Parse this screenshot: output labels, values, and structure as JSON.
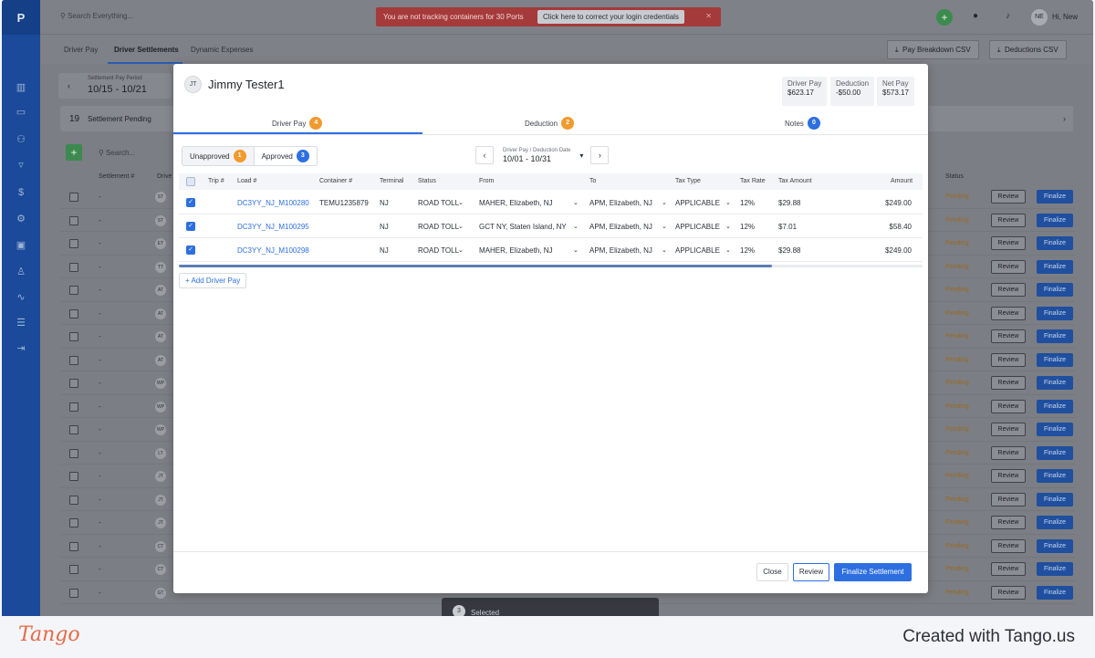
{
  "app": {
    "logo": "P",
    "search_placeholder": "Search Everything...",
    "alert_text": "You are not tracking containers for 30 Ports",
    "alert_button": "Click here to correct your login credentials",
    "alert_close": "✕",
    "user_initials": "NE",
    "user_greeting": "Hi, New"
  },
  "subtabs": [
    "Driver Pay",
    "Driver Settlements",
    "Dynamic Expenses"
  ],
  "csv_buttons": [
    "Pay Breakdown CSV",
    "Deductions CSV"
  ],
  "background": {
    "period_label": "Settlement Pay Period",
    "period_value": "10/15 - 10/21",
    "pending_count": "19",
    "pending_label": "Settlement Pending",
    "search_placeholder": "Search...",
    "col_settlement": "Settlement #",
    "col_driver": "Drive",
    "col_status": "Status",
    "rows": [
      {
        "ini": "ST",
        "status": "Pending"
      },
      {
        "ini": "ST",
        "status": "Pending"
      },
      {
        "ini": "ET",
        "status": "Pending"
      },
      {
        "ini": "TT",
        "status": "Pending"
      },
      {
        "ini": "AT",
        "status": "Pending"
      },
      {
        "ini": "AT",
        "status": "Pending"
      },
      {
        "ini": "AT",
        "status": "Pending"
      },
      {
        "ini": "AT",
        "status": "Pending"
      },
      {
        "ini": "WP",
        "status": "Pending"
      },
      {
        "ini": "WP",
        "status": "Pending"
      },
      {
        "ini": "WP",
        "status": "Pending"
      },
      {
        "ini": "LT",
        "status": "Pending"
      },
      {
        "ini": "JT",
        "status": "Pending"
      },
      {
        "ini": "JT",
        "status": "Pending"
      },
      {
        "ini": "JT",
        "status": "Pending"
      },
      {
        "ini": "CT",
        "status": "Pending"
      },
      {
        "ini": "CT",
        "status": "Pending"
      },
      {
        "ini": "GT",
        "status": "Pending"
      }
    ],
    "review_label": "Review",
    "finalize_label": "Finalize",
    "selected_count": "3",
    "selected_label": "Selected"
  },
  "modal": {
    "initials": "JT",
    "driver_name": "Jimmy Tester1",
    "summary": [
      {
        "label": "Driver Pay",
        "value": "$623.17"
      },
      {
        "label": "Deduction",
        "value": "-$50.00"
      },
      {
        "label": "Net Pay",
        "value": "$573.17"
      }
    ],
    "tabs": [
      {
        "label": "Driver Pay",
        "count": "4",
        "color": "orange"
      },
      {
        "label": "Deduction",
        "count": "2",
        "color": "orange"
      },
      {
        "label": "Notes",
        "count": "0",
        "color": "blue"
      }
    ],
    "toggle": [
      {
        "label": "Unapproved",
        "count": "1"
      },
      {
        "label": "Approved",
        "count": "3"
      }
    ],
    "date_label": "Driver Pay / Deduction Date",
    "date_value": "10/01 - 10/31",
    "columns": [
      "Trip #",
      "Load #",
      "Container #",
      "Terminal",
      "Status",
      "From",
      "To",
      "Tax Type",
      "Tax Rate",
      "Tax Amount",
      "Amount"
    ],
    "rows": [
      {
        "load": "DC3YY_NJ_M100280",
        "container": "TEMU1235879",
        "terminal": "NJ",
        "status": "ROAD TOLL",
        "from": "MAHER, Elizabeth, NJ",
        "to": "APM, Elizabeth, NJ",
        "tax_type": "APPLICABLE",
        "tax_rate": "12%",
        "tax_amount": "$29.88",
        "amount": "$249.00"
      },
      {
        "load": "DC3YY_NJ_M100295",
        "container": "",
        "terminal": "NJ",
        "status": "ROAD TOLL",
        "from": "GCT NY, Staten Island, NY",
        "to": "APM, Elizabeth, NJ",
        "tax_type": "APPLICABLE",
        "tax_rate": "12%",
        "tax_amount": "$7.01",
        "amount": "$58.40"
      },
      {
        "load": "DC3YY_NJ_M100298",
        "container": "",
        "terminal": "NJ",
        "status": "ROAD TOLL",
        "from": "MAHER, Elizabeth, NJ",
        "to": "APM, Elizabeth, NJ",
        "tax_type": "APPLICABLE",
        "tax_rate": "12%",
        "tax_amount": "$29.88",
        "amount": "$249.00"
      }
    ],
    "add_button": "Add Driver Pay",
    "footer": {
      "close": "Close",
      "review": "Review",
      "finalize": "Finalize Settlement"
    }
  },
  "tango": {
    "logo": "Tango",
    "credit": "Created with Tango.us"
  },
  "colors": {
    "primary": "#2d6fe0",
    "badge_orange": "#f29a2e",
    "sidebar": "#1a4a99",
    "alert": "#a53a3a"
  }
}
